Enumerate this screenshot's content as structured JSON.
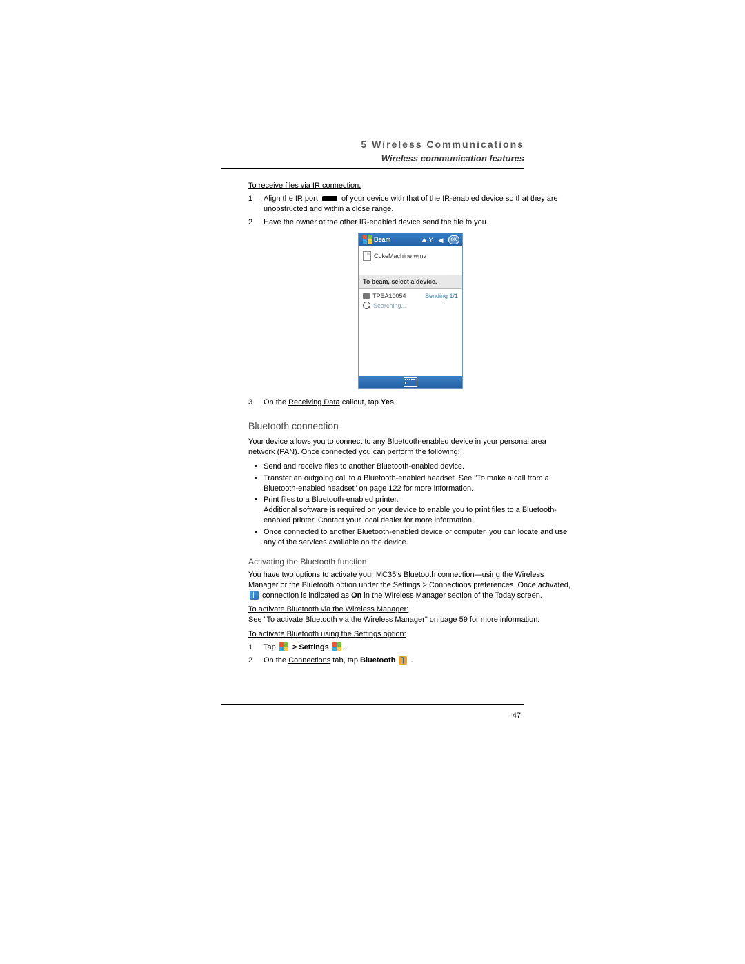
{
  "header": {
    "chapter": "5 Wireless Communications",
    "subhead": "Wireless communication features"
  },
  "sec1": {
    "title": "To receive files via IR connection:",
    "steps": [
      {
        "n": "1",
        "pre": "Align the IR port ",
        "post": " of your device with that of the IR-enabled device so that they are unobstructed and within a close range."
      },
      {
        "n": "2",
        "text": "Have the owner of the other IR-enabled device send the file to you."
      }
    ]
  },
  "shot": {
    "title": "Beam",
    "ok": "ok",
    "file": "CokeMachine.wmv",
    "bar": "To beam, select a device.",
    "dev": "TPEA10054",
    "status": "Sending 1/1",
    "search": "Searching..."
  },
  "step3": {
    "n": "3",
    "pre": "On the ",
    "link": "Receiving Data",
    "mid": " callout, tap ",
    "bold": "Yes",
    "post": "."
  },
  "bt": {
    "heading": "Bluetooth connection",
    "intro": "Your device allows you to connect to any Bluetooth-enabled device in your personal area network (PAN). Once connected you can perform the following:",
    "bul": [
      "Send and receive files to another Bluetooth-enabled device.",
      "Transfer an outgoing call to a Bluetooth-enabled headset. See \"To make a call from a Bluetooth-enabled headset\" on page 122 for more information.",
      "Print files to a Bluetooth-enabled printer.",
      "Once connected to another Bluetooth-enabled device or computer, you can locate and use any of the services available on the device."
    ],
    "note": "Additional software is required on your device to enable you to print files to a Bluetooth-enabled printer. Contact your local dealer for more information.",
    "act_head": "Activating the Bluetooth function",
    "act_p1_a": "You have two options to activate your MC35's Bluetooth connection—using the Wireless Manager or the Bluetooth option under the Settings > Connections preferences. Once activated, ",
    "act_p1_b": " connection is indicated as ",
    "act_on": "On",
    "act_p1_c": " in the Wireless Manager section of the Today screen.",
    "via_wm": "To activate Bluetooth via the Wireless Manager:",
    "via_wm_text": "See \"To activate Bluetooth via the Wireless Manager\" on page 59 for more information.",
    "via_set": "To activate Bluetooth using the Settings option:",
    "s1": {
      "n": "1",
      "pre": "Tap ",
      "mid": " > ",
      "bold": "Settings",
      "post": " ",
      "end": "."
    },
    "s2": {
      "n": "2",
      "pre": "On the ",
      "link": "Connections",
      "mid": " tab, tap ",
      "bold": "Bluetooth",
      "post": " ",
      "end": " ."
    }
  },
  "page": "47"
}
